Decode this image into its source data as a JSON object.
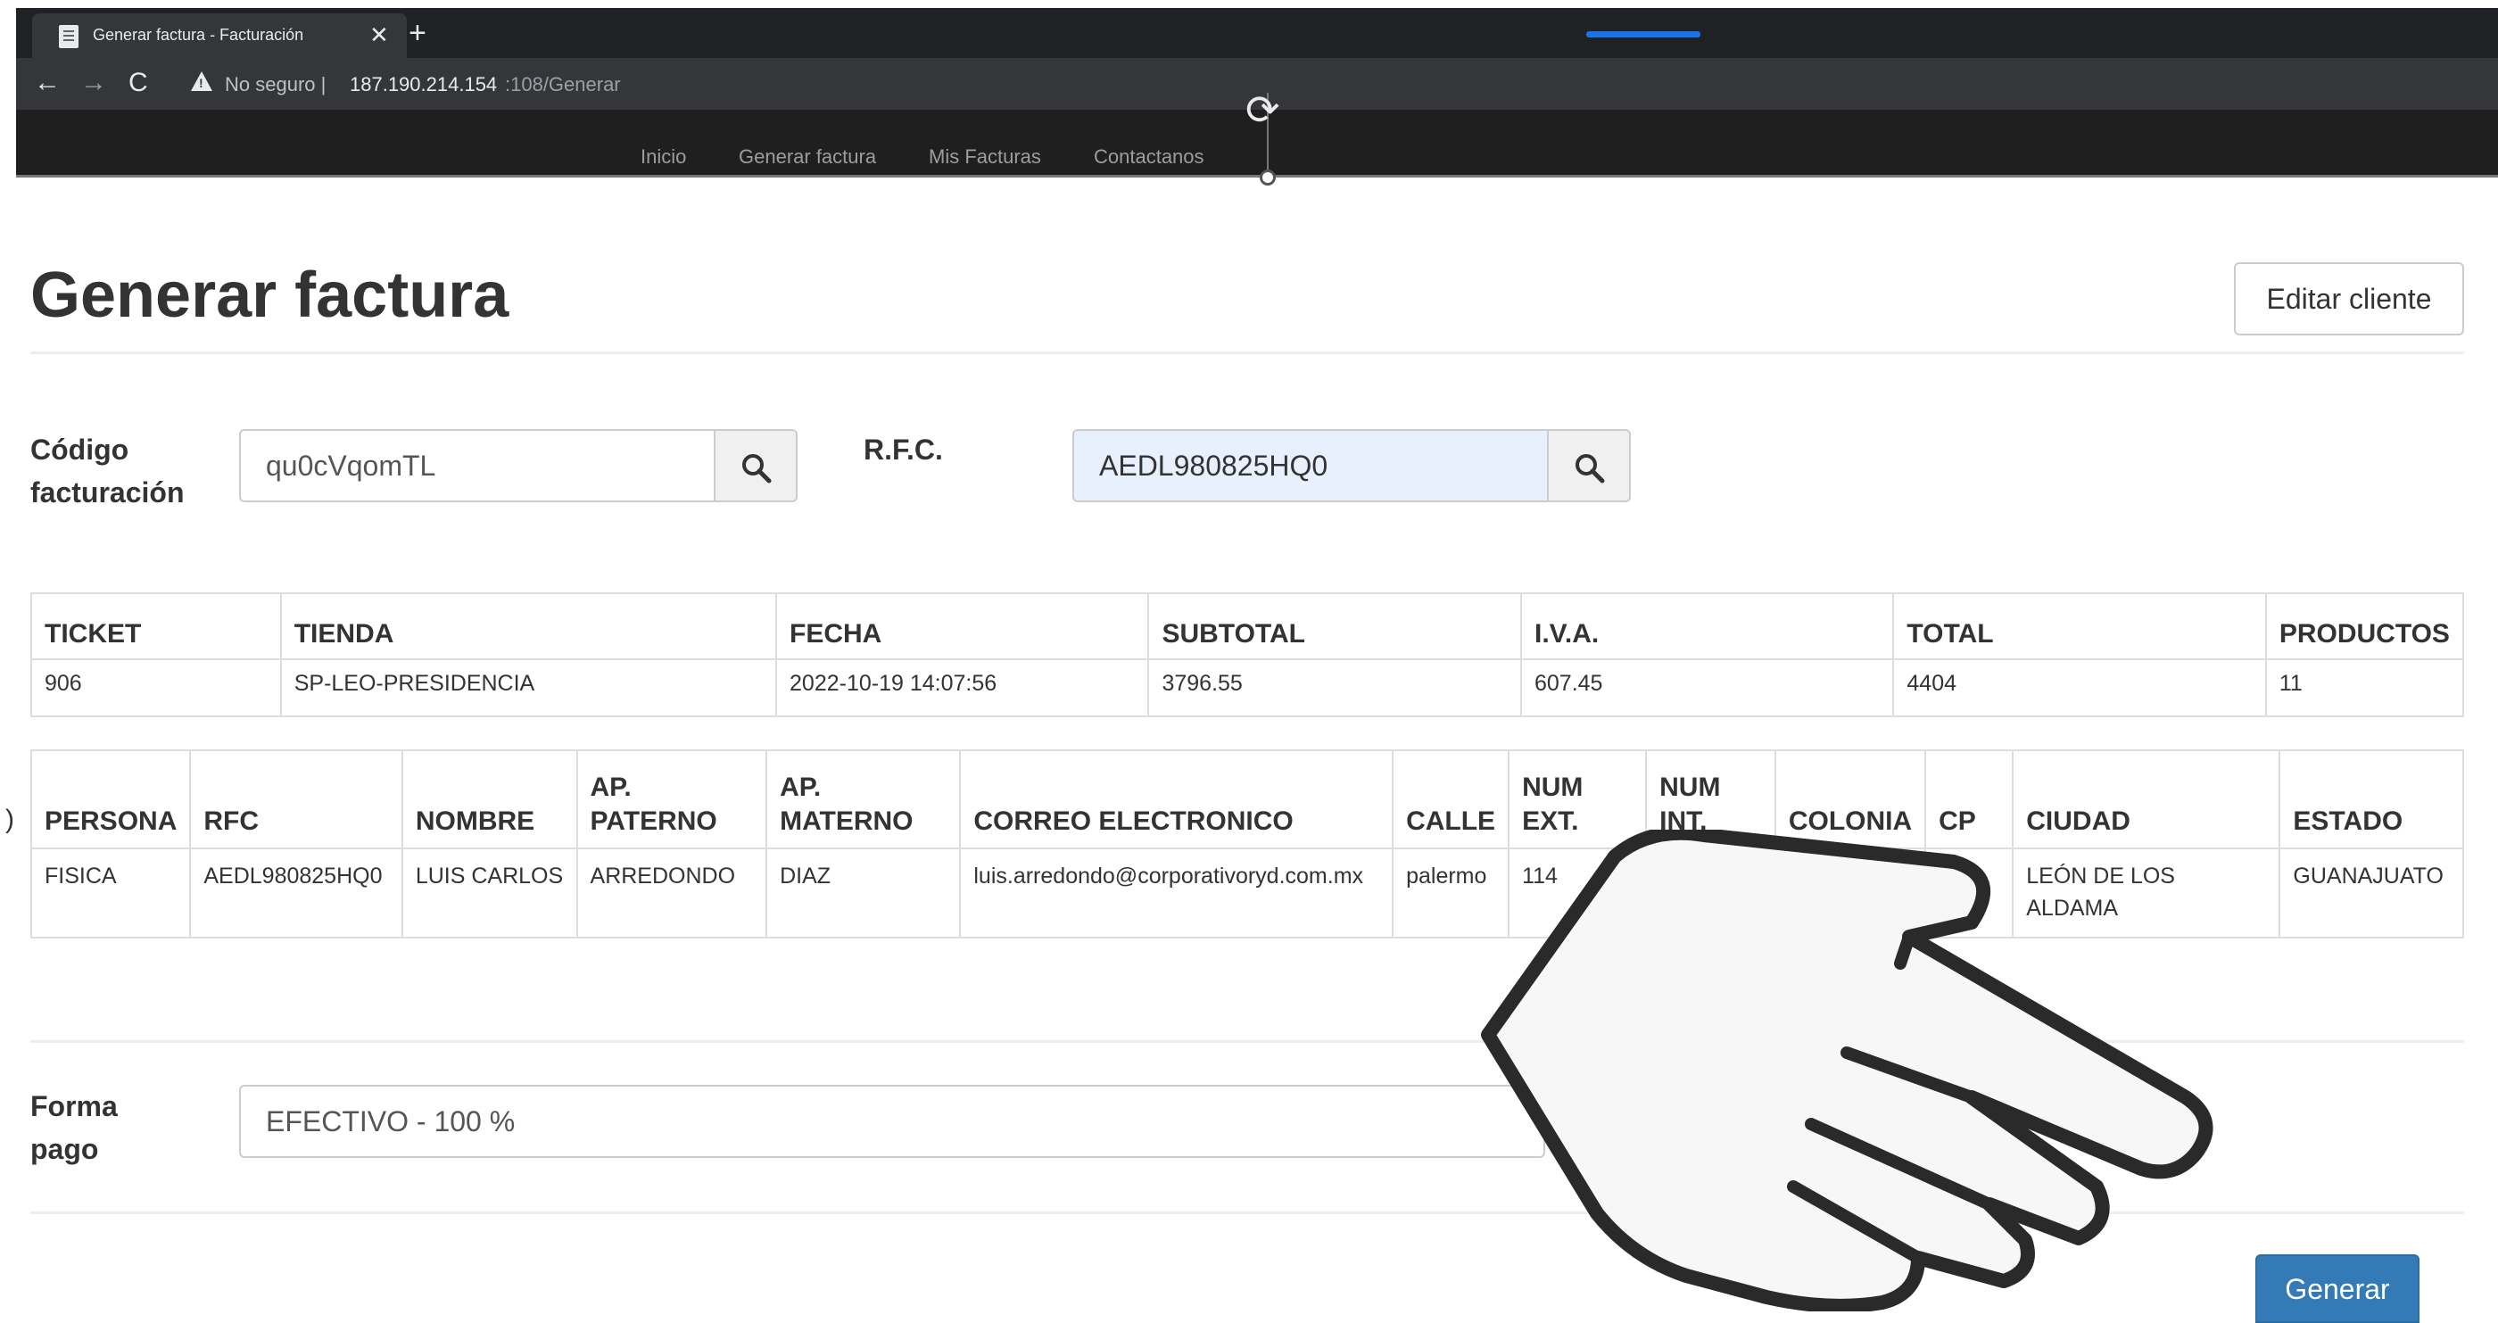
{
  "browser": {
    "tab_title": "Generar factura - Facturación",
    "tab_close": "✕",
    "new_tab": "+",
    "back": "←",
    "forward": "→",
    "reload": "C",
    "security_text": "No seguro  |",
    "url_host": "187.190.214.154",
    "url_path": ":108/Generar"
  },
  "navbar": {
    "items": [
      "Inicio",
      "Generar factura",
      "Mis Facturas",
      "Contactanos"
    ]
  },
  "page": {
    "title": "Generar factura",
    "edit_client_label": "Editar cliente"
  },
  "search": {
    "codigo_label_line1": "Código",
    "codigo_label_line2": "facturación",
    "codigo_value": "qu0cVqomTL",
    "rfc_label": "R.F.C.",
    "rfc_value": "AEDL980825HQ0"
  },
  "ticket_table": {
    "headers": [
      "TICKET",
      "TIENDA",
      "FECHA",
      "SUBTOTAL",
      "I.V.A.",
      "TOTAL",
      "PRODUCTOS"
    ],
    "row": [
      "906",
      "SP-LEO-PRESIDENCIA",
      "2022-10-19 14:07:56",
      "3796.55",
      "607.45",
      "4404",
      "11"
    ]
  },
  "client_table": {
    "headers": [
      "PERSONA",
      "RFC",
      "NOMBRE",
      "AP. PATERNO",
      "AP. MATERNO",
      "CORREO ELECTRONICO",
      "CALLE",
      "NUM EXT.",
      "NUM INT.",
      "COLONIA",
      "CP",
      "CIUDAD",
      "ESTADO"
    ],
    "row": [
      "FISICA",
      "AEDL980825HQ0",
      "LUIS CARLOS",
      "ARREDONDO",
      "DIAZ",
      "luis.arredondo@corporativoryd.com.mx",
      "palermo",
      "114",
      "",
      "",
      "",
      "LEÓN DE LOS ALDAMA",
      "GUANAJUATO"
    ]
  },
  "side_glyph": ")",
  "pago": {
    "label_line1": "Forma",
    "label_line2": "pago",
    "value": "EFECTIVO - 100 %"
  },
  "actions": {
    "generar_label": "Generar"
  },
  "colors": {
    "primary": "#337ab7",
    "chrome_dark": "#1f1f1f",
    "rfc_input_bg": "#e8f0fe"
  }
}
